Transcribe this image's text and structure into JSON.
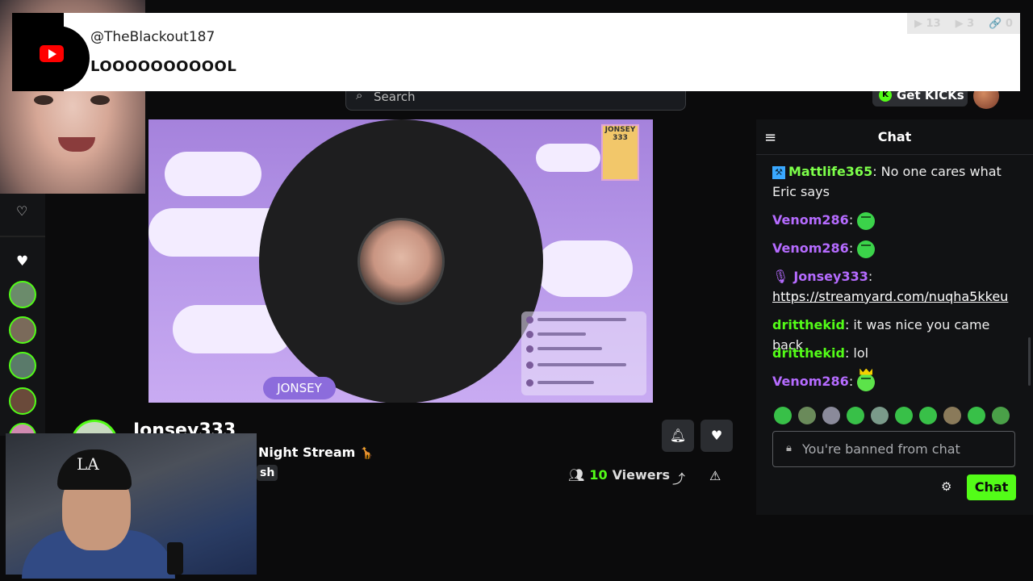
{
  "alert": {
    "username": "@TheBlackout187",
    "message": "LOOOOOOOOOOL"
  },
  "counters": {
    "kick_count": "13",
    "youtube_count": "3",
    "link_count": "0"
  },
  "header": {
    "search_placeholder": "Search",
    "get_kicks_label": "Get KICKs"
  },
  "player": {
    "name_tag": "JONSEY",
    "badge_text": "JONSEY 333"
  },
  "channel": {
    "name": "Jonsey333",
    "stream_title": "Night Stream",
    "title_emoji": "🦒",
    "category_fragment": "sh",
    "viewers_count": "10",
    "viewers_label": "Viewers"
  },
  "chat": {
    "title": "Chat",
    "messages": [
      {
        "user": "Mattlife365",
        "text": " No one cares what Eric says"
      },
      {
        "user": "Venom286",
        "text": ""
      },
      {
        "user": "Venom286",
        "text": ""
      },
      {
        "user": "Jonsey333",
        "text": "",
        "link": "https://streamyard.com/nuqha5kkeu"
      },
      {
        "user": "dritthekid",
        "text": " it was nice you came back"
      },
      {
        "user": "dritthekid",
        "text": " lol"
      },
      {
        "user": "Venom286",
        "text": ""
      }
    ],
    "ban_placeholder": "You're banned from chat",
    "send_label": "Chat"
  },
  "colors": {
    "accent": "#53fc18",
    "chat_bg": "#111214",
    "page_bg": "#0b0b0c"
  }
}
